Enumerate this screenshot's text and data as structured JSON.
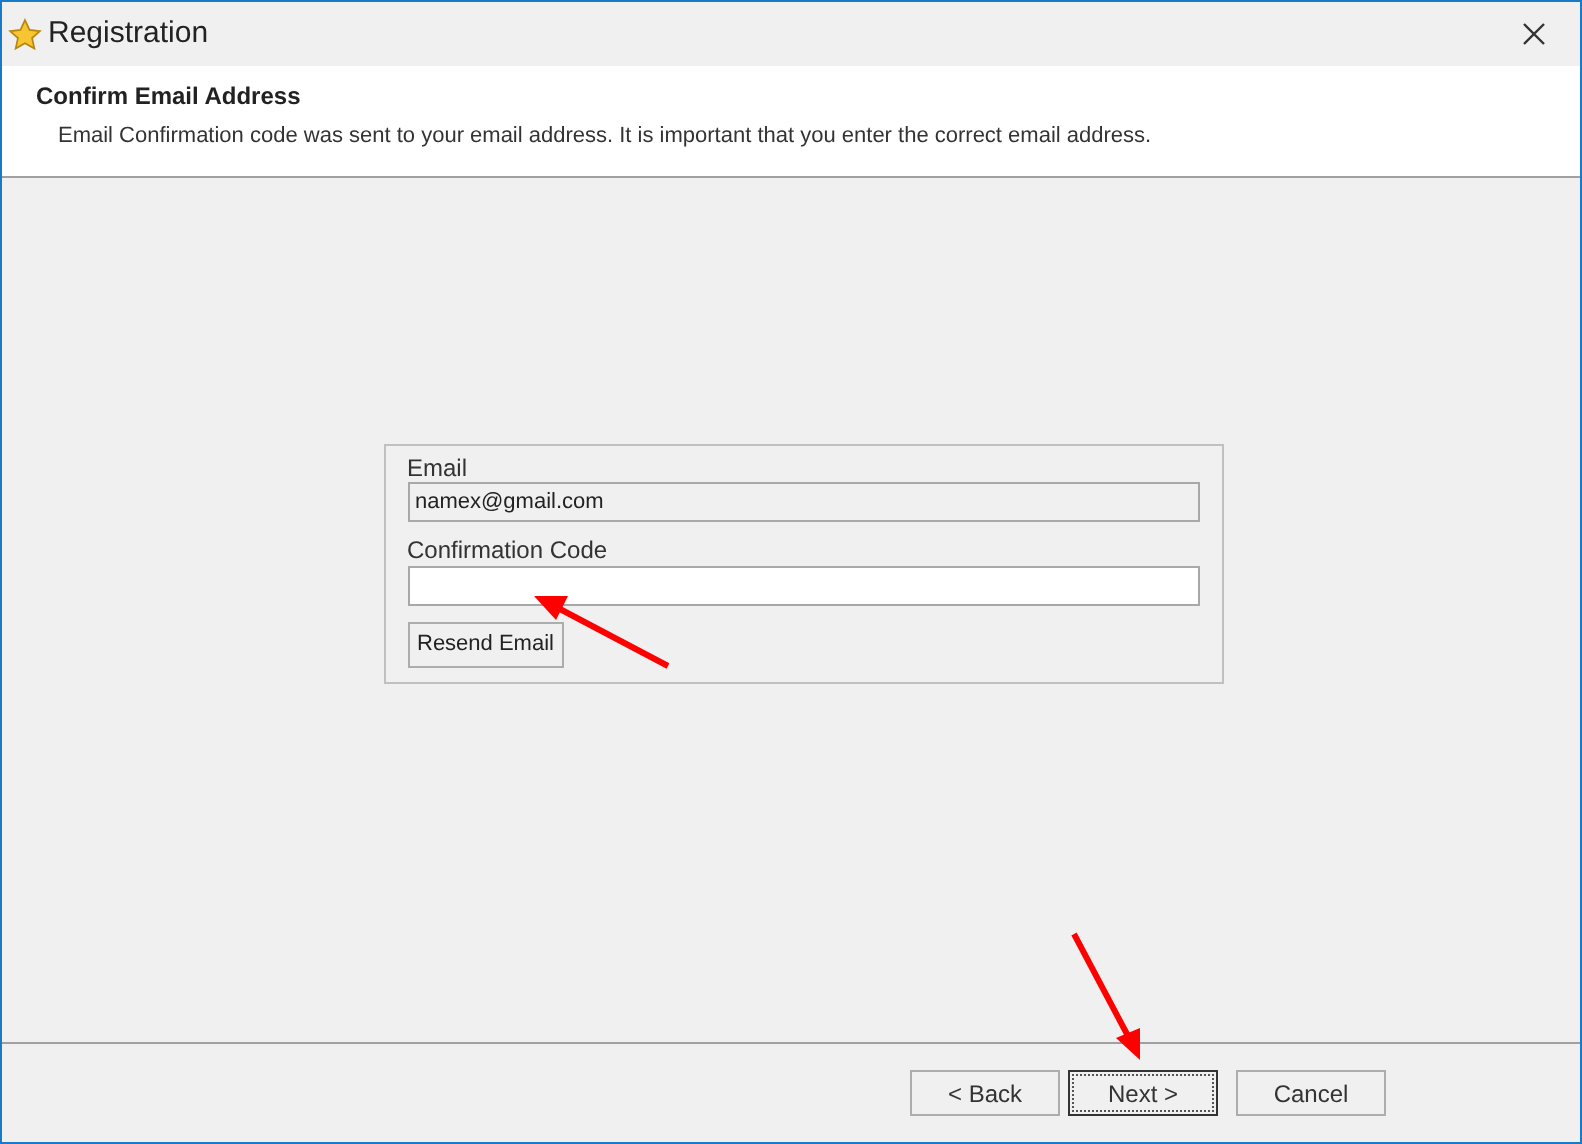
{
  "window": {
    "title": "Registration"
  },
  "header": {
    "title": "Confirm Email Address",
    "description": "Email Confirmation code was sent to your email address. It is important that you enter the correct email address."
  },
  "form": {
    "email_label": "Email",
    "email_value": "namex@gmail.com",
    "code_label": "Confirmation Code",
    "resend_button": "Resend Email"
  },
  "buttons": [
    {
      "label": "< Back",
      "focused": false
    },
    {
      "label": "Next >",
      "focused": true
    },
    {
      "label": "Cancel",
      "focused": false
    }
  ]
}
